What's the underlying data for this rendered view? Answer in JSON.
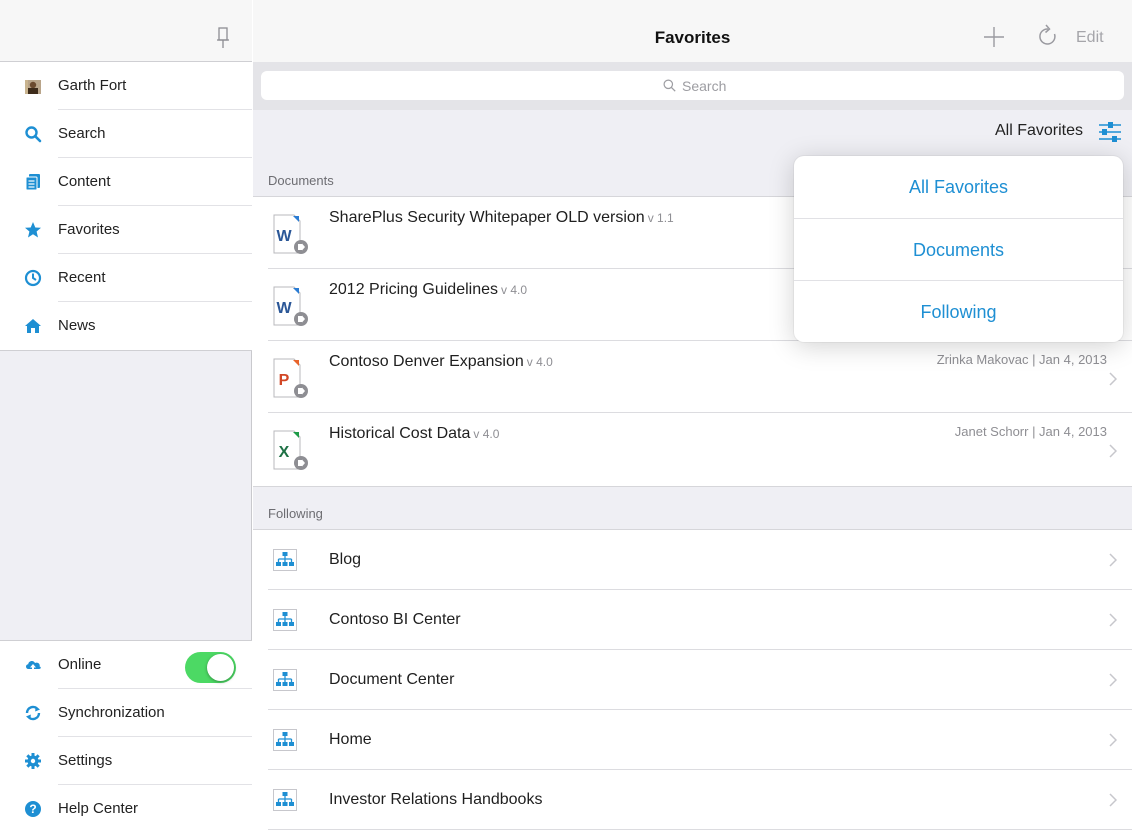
{
  "app": {
    "title": "Favorites",
    "accent_color": "#1e8fd3",
    "toggle_on_color": "#4cd964"
  },
  "sidebar": {
    "pin_icon": "pin-icon",
    "items": [
      {
        "label": "Garth Fort",
        "icon": "user-avatar-icon"
      },
      {
        "label": "Search",
        "icon": "search-icon"
      },
      {
        "label": "Content",
        "icon": "content-icon"
      },
      {
        "label": "Favorites",
        "icon": "star-icon"
      },
      {
        "label": "Recent",
        "icon": "clock-icon"
      },
      {
        "label": "News",
        "icon": "home-icon"
      }
    ],
    "bottom_items": [
      {
        "label": "Online",
        "icon": "cloud-upload-icon",
        "toggle": true
      },
      {
        "label": "Synchronization",
        "icon": "sync-icon"
      },
      {
        "label": "Settings",
        "icon": "gear-icon"
      },
      {
        "label": "Help Center",
        "icon": "help-icon"
      }
    ]
  },
  "navbar": {
    "title": "Favorites",
    "add_icon": "plus-icon",
    "refresh_icon": "refresh-icon",
    "edit_label": "Edit"
  },
  "search": {
    "placeholder": "Search"
  },
  "filter": {
    "label": "All Favorites",
    "icon": "filter-sliders-icon"
  },
  "sections": {
    "documents_header": "Documents",
    "following_header": "Following"
  },
  "documents": [
    {
      "title": "SharePlus Security Whitepaper OLD version",
      "version": "v 1.1",
      "type": "word",
      "meta": ""
    },
    {
      "title": "2012 Pricing Guidelines",
      "version": "v 4.0",
      "type": "word",
      "meta": ""
    },
    {
      "title": "Contoso Denver Expansion",
      "version": "v 4.0",
      "type": "powerpoint",
      "meta": "Zrinka Makovac | Jan 4, 2013"
    },
    {
      "title": "Historical Cost Data",
      "version": "v 4.0",
      "type": "excel",
      "meta": "Janet Schorr | Jan 4, 2013"
    }
  ],
  "following": [
    {
      "label": "Blog",
      "icon": "site-icon"
    },
    {
      "label": "Contoso BI Center",
      "icon": "site-icon"
    },
    {
      "label": "Document Center",
      "icon": "site-icon"
    },
    {
      "label": "Home",
      "icon": "site-icon"
    },
    {
      "label": "Investor Relations Handbooks",
      "icon": "site-icon"
    }
  ],
  "filter_popover": {
    "options": [
      "All Favorites",
      "Documents",
      "Following"
    ],
    "selected": "All Favorites"
  }
}
